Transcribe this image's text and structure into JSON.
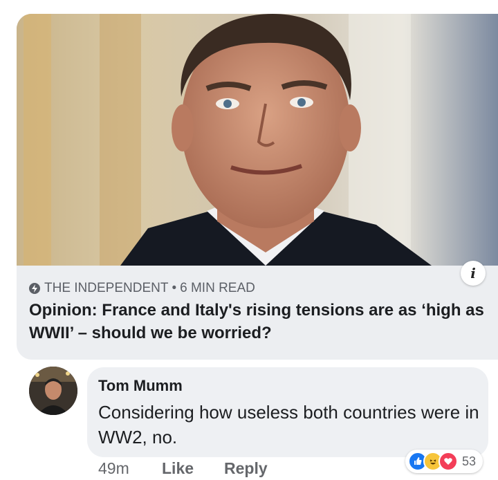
{
  "link_preview": {
    "source": "THE INDEPENDENT",
    "separator": "•",
    "read_time": "6 MIN READ",
    "headline": "Opinion: France and Italy's rising tensions are as ‘high as WWII’ – should we be worried?",
    "info_glyph": "i"
  },
  "comment": {
    "author": "Tom Mumm",
    "text": "Considering how useless both countries were in WW2, no.",
    "time": "49m",
    "like_label": "Like",
    "reply_label": "Reply",
    "reaction_count": "53",
    "reactions": [
      "like-icon",
      "haha-icon",
      "love-icon"
    ]
  },
  "colors": {
    "text": "#1c1e21",
    "muted": "#65676b",
    "bubble": "#eef0f3",
    "card": "#eceef1",
    "like": "#1877f2",
    "haha": "#f7c53a",
    "love": "#f33e58"
  }
}
